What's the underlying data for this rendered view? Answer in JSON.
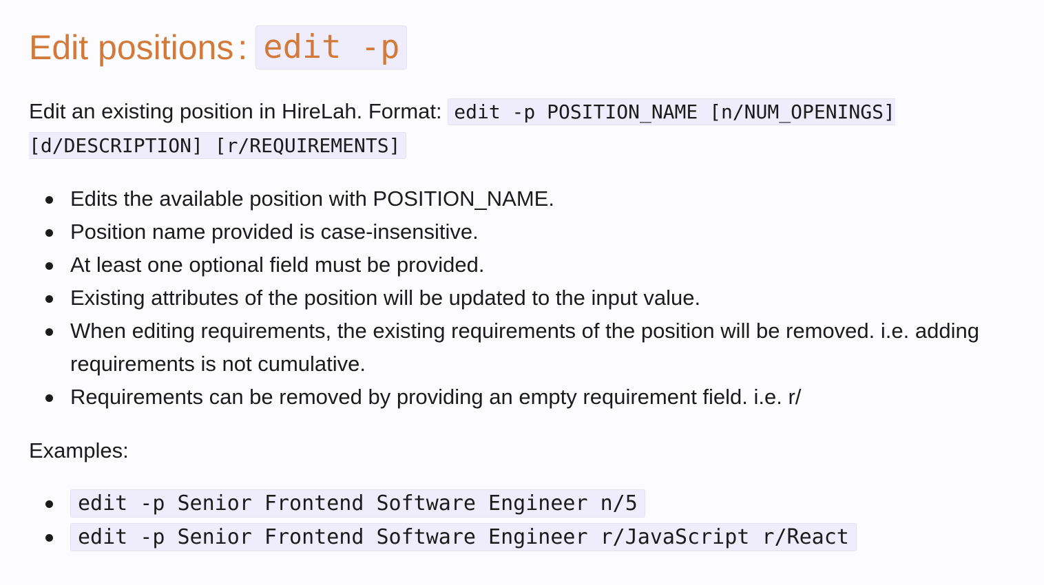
{
  "heading": {
    "text": "Edit positions",
    "separator": ":",
    "command": "edit -p"
  },
  "intro": {
    "text": "Edit an existing position in HireLah. Format: ",
    "format": "edit -p POSITION_NAME [n/NUM_OPENINGS] [d/DESCRIPTION] [r/REQUIREMENTS]"
  },
  "rules": [
    "Edits the available position with POSITION_NAME.",
    "Position name provided is case-insensitive.",
    "At least one optional field must be provided.",
    "Existing attributes of the position will be updated to the input value.",
    "When editing requirements, the existing requirements of the position will be removed. i.e. adding requirements is not cumulative.",
    "Requirements can be removed by providing an empty requirement field. i.e. r/"
  ],
  "examples_label": "Examples:",
  "examples": [
    "edit -p Senior Frontend Software Engineer n/5",
    "edit -p Senior Frontend Software Engineer r/JavaScript r/React"
  ]
}
